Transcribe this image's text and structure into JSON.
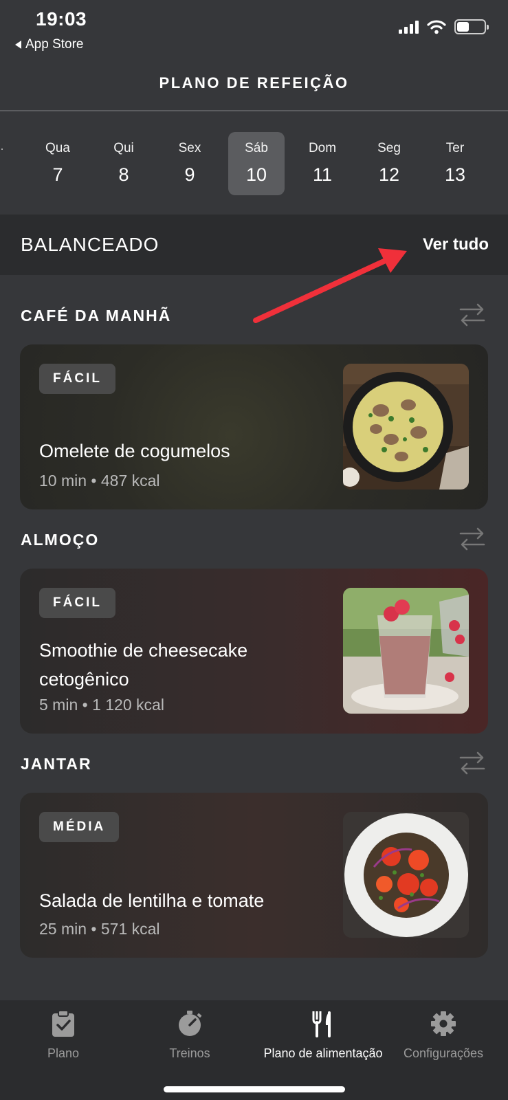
{
  "status_bar": {
    "time": "19:03",
    "back_label": "App Store"
  },
  "header": {
    "title": "PLANO DE REFEIÇÃO"
  },
  "days": [
    {
      "name": "Qua",
      "num": "7"
    },
    {
      "name": "Qui",
      "num": "8"
    },
    {
      "name": "Sex",
      "num": "9"
    },
    {
      "name": "Sáb",
      "num": "10",
      "selected": true
    },
    {
      "name": "Dom",
      "num": "11"
    },
    {
      "name": "Seg",
      "num": "12"
    },
    {
      "name": "Ter",
      "num": "13"
    }
  ],
  "plan": {
    "title": "BALANCEADO",
    "see_all": "Ver tudo"
  },
  "meals": [
    {
      "section": "CAFÉ DA MANHÃ",
      "badge": "FÁCIL",
      "title": "Omelete de cogumelos",
      "meta": "10 min • 487 kcal"
    },
    {
      "section": "ALMOÇO",
      "badge": "FÁCIL",
      "title": "Smoothie de cheesecake cetogênico",
      "meta": "5 min • 1 120 kcal"
    },
    {
      "section": "JANTAR",
      "badge": "MÉDIA",
      "title": "Salada de lentilha e tomate",
      "meta": "25 min • 571 kcal"
    }
  ],
  "tabbar": {
    "plan": "Plano",
    "workouts": "Treinos",
    "meal_plan": "Plano de alimentação",
    "settings": "Configurações"
  },
  "colors": {
    "background": "#36373a",
    "band": "#2b2c2e",
    "annotation_arrow": "#f0303a"
  }
}
